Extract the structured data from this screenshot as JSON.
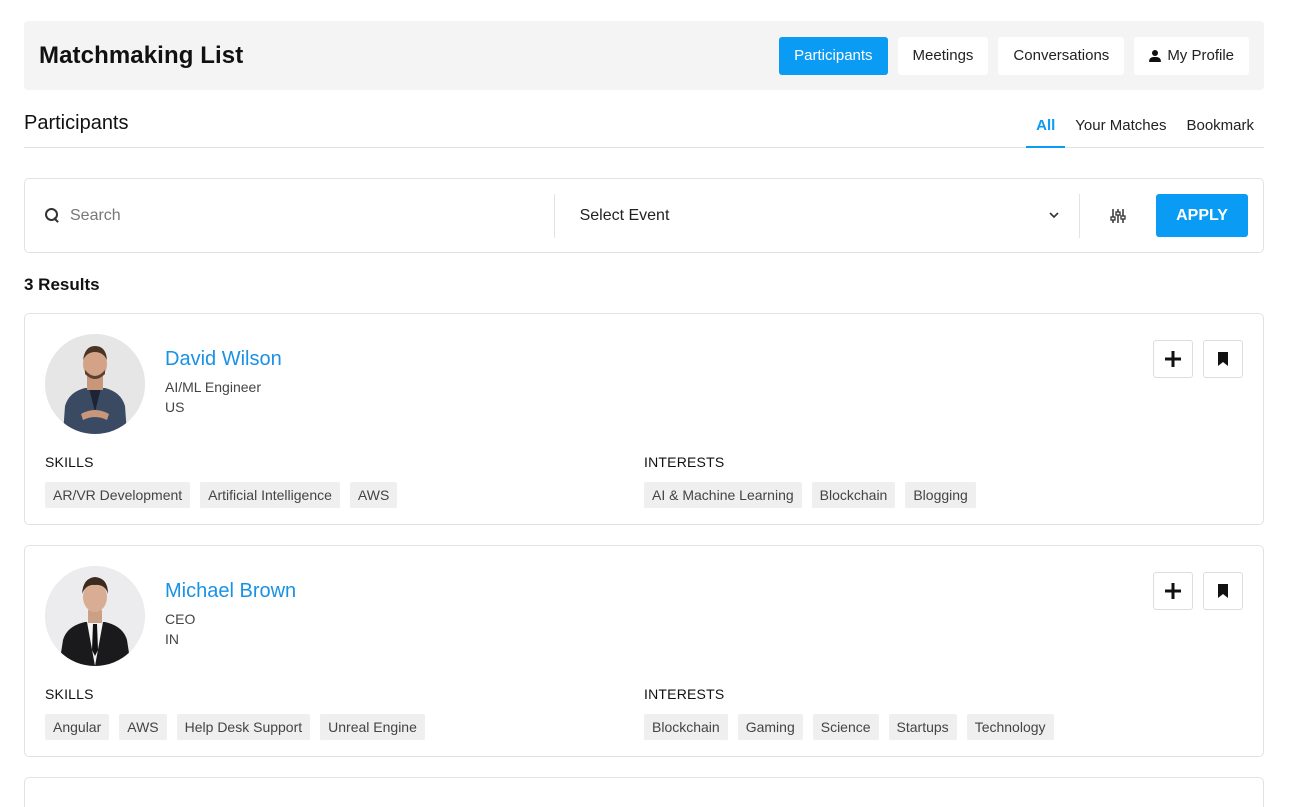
{
  "header": {
    "title": "Matchmaking List",
    "nav": [
      {
        "label": "Participants",
        "active": true
      },
      {
        "label": "Meetings",
        "active": false
      },
      {
        "label": "Conversations",
        "active": false
      },
      {
        "label": "My Profile",
        "active": false
      }
    ]
  },
  "section": {
    "title": "Participants",
    "tabs": [
      {
        "label": "All",
        "active": true
      },
      {
        "label": "Your Matches",
        "active": false
      },
      {
        "label": "Bookmark",
        "active": false
      }
    ]
  },
  "filter": {
    "search_placeholder": "Search",
    "select_value": "Select Event",
    "apply_label": "APPLY"
  },
  "results_label": "3 Results",
  "participants": [
    {
      "name": "David Wilson",
      "role": "AI/ML Engineer",
      "country": "US",
      "skills_label": "SKILLS",
      "interests_label": "INTERESTS",
      "skills": [
        "AR/VR Development",
        "Artificial Intelligence",
        "AWS"
      ],
      "interests": [
        "AI & Machine Learning",
        "Blockchain",
        "Blogging"
      ]
    },
    {
      "name": "Michael Brown",
      "role": "CEO",
      "country": "IN",
      "skills_label": "SKILLS",
      "interests_label": "INTERESTS",
      "skills": [
        "Angular",
        "AWS",
        "Help Desk Support",
        "Unreal Engine"
      ],
      "interests": [
        "Blockchain",
        "Gaming",
        "Science",
        "Startups",
        "Technology"
      ]
    }
  ],
  "colors": {
    "accent": "#0a9bf5",
    "name_link": "#1991e5"
  },
  "icons": {
    "search": "search-icon",
    "chevron": "chevron-down-icon",
    "filter": "sliders-icon",
    "add": "plus-icon",
    "bookmark": "bookmark-icon",
    "profile": "user-icon"
  }
}
